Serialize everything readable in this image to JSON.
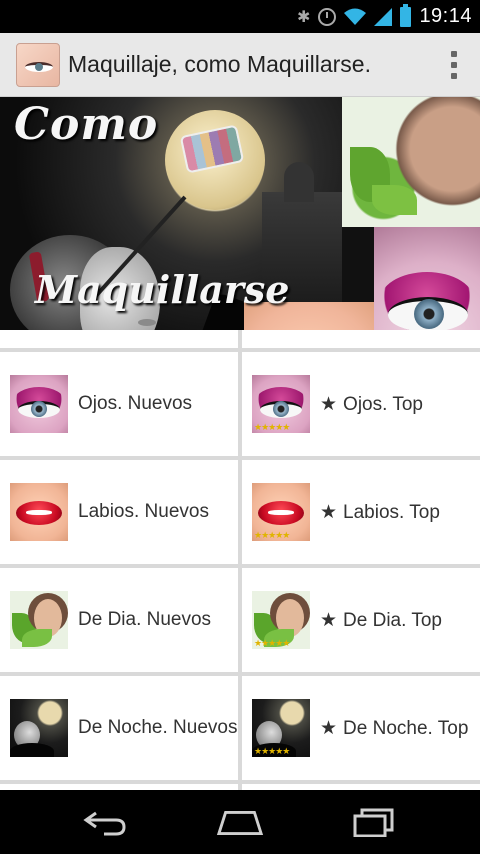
{
  "status_bar": {
    "time": "19:14",
    "icons": [
      "bluetooth-icon",
      "alarm-icon",
      "wifi-icon",
      "signal-icon",
      "battery-icon"
    ],
    "accent_color": "#33b5e5"
  },
  "action_bar": {
    "title": "Maquillaje, como Maquillarse.",
    "background": "#e8e8e8"
  },
  "banner": {
    "text_top": "Como",
    "text_bottom": "Maquillarse"
  },
  "menu": {
    "items": [
      {
        "prefix": "",
        "label": "Ojos. Nuevos",
        "thumb": "eye",
        "rated": false
      },
      {
        "prefix": "★",
        "label": "Ojos. Top",
        "thumb": "eye",
        "rated": true
      },
      {
        "prefix": "",
        "label": "Labios. Nuevos",
        "thumb": "lips",
        "rated": false
      },
      {
        "prefix": "★",
        "label": "Labios. Top",
        "thumb": "lips",
        "rated": true
      },
      {
        "prefix": "",
        "label": "De Dia. Nuevos",
        "thumb": "day",
        "rated": false
      },
      {
        "prefix": "★",
        "label": "De Dia. Top",
        "thumb": "day",
        "rated": true
      },
      {
        "prefix": "",
        "label": "De Noche. Nuevos",
        "thumb": "night",
        "rated": false
      },
      {
        "prefix": "★",
        "label": "De Noche. Top",
        "thumb": "night",
        "rated": true
      }
    ],
    "stars_text": "★★★★★"
  },
  "nav_bar": {
    "buttons": [
      "back-icon",
      "home-icon",
      "recent-apps-icon"
    ]
  }
}
